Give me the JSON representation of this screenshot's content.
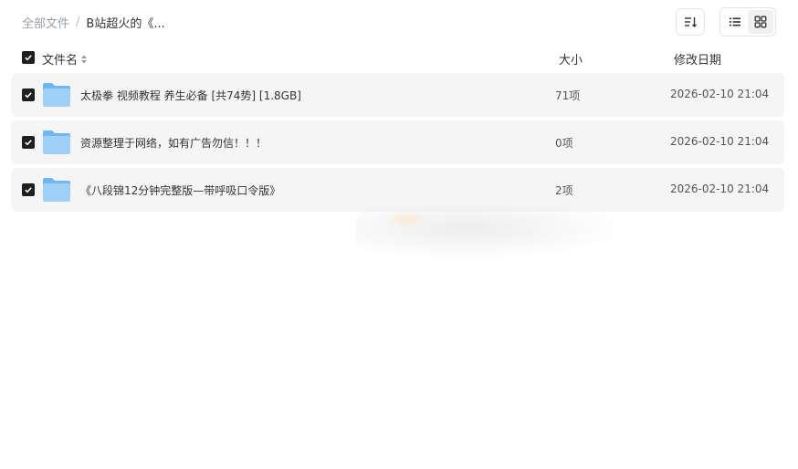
{
  "breadcrumb": {
    "root": "全部文件",
    "separator": "/",
    "current": "B站超火的《..."
  },
  "toolbar": {
    "sort_icon": "sort-icon",
    "list_view_icon": "list-view-icon",
    "grid_view_icon": "grid-view-icon",
    "active_view": "list"
  },
  "table": {
    "columns": {
      "name": "文件名",
      "size": "大小",
      "date": "修改日期"
    },
    "rows": [
      {
        "name": "太极拳 视频教程 养生必备 [共74势] [1.8GB]",
        "size": "71项",
        "date": "2026-02-10 21:04",
        "checked": true
      },
      {
        "name": "资源整理于网络，如有广告勿信！！！",
        "size": "0项",
        "date": "2026-02-10 21:04",
        "checked": true
      },
      {
        "name": "《八段锦12分钟完整版—带呼吸口令版》",
        "size": "2项",
        "date": "2026-02-10 21:04",
        "checked": true
      }
    ]
  },
  "colors": {
    "row_background": "#f5f5f5",
    "checkbox": "#1f1f1f",
    "folder_light": "#9fd0f8",
    "folder_dark": "#6fb6f2"
  }
}
